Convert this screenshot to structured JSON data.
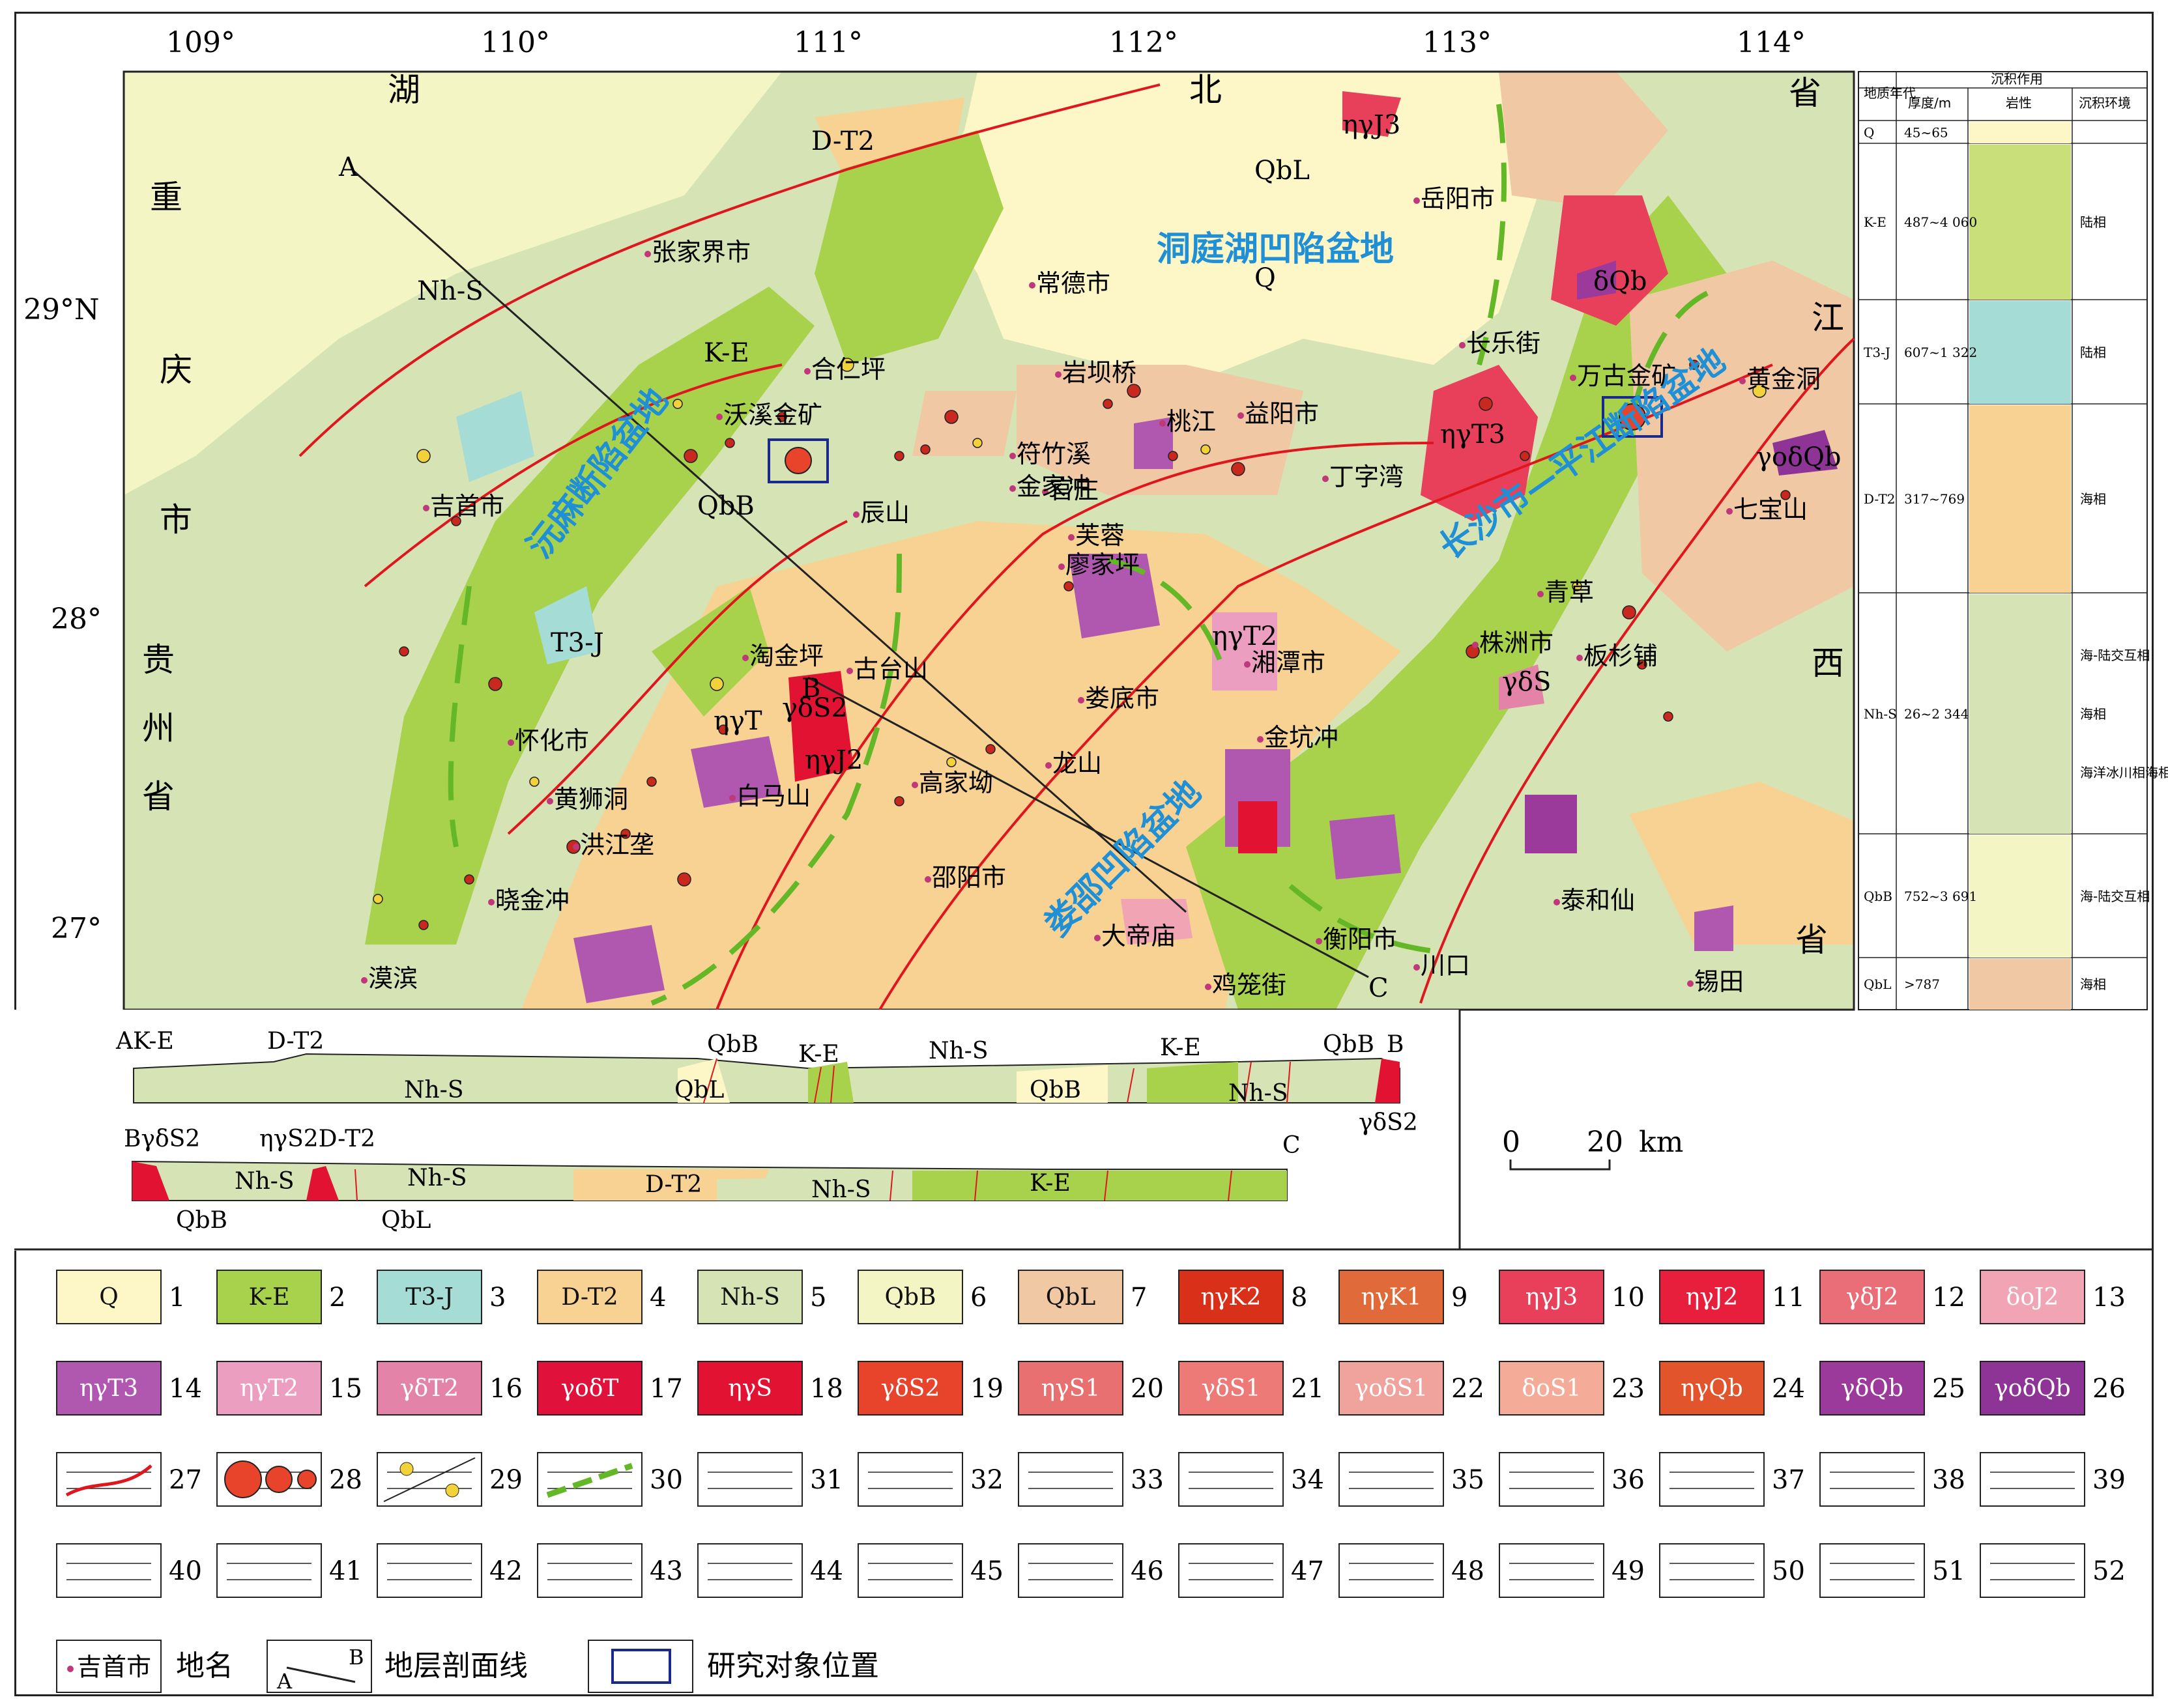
{
  "longitudes": [
    "109°",
    "110°",
    "111°",
    "112°",
    "113°",
    "114°"
  ],
  "latitudes": [
    "29°N",
    "28°",
    "27°"
  ],
  "province_labels": {
    "hubei": [
      "湖",
      "北",
      "省"
    ],
    "jiangxi": [
      "江",
      "西",
      "省"
    ],
    "chongqing": [
      "重",
      "庆",
      "市"
    ],
    "guizhou": [
      "贵",
      "州",
      "省"
    ]
  },
  "basin_labels": {
    "dongting": "洞庭湖凹陷盆地",
    "yuanma": "沅麻断陷盆地",
    "loushao": "娄邵凹陷盆地",
    "changping": "长沙市—平江断陷盆地"
  },
  "cities": [
    "张家界市",
    "常德市",
    "岳阳市",
    "吉首市",
    "桃江",
    "益阳市",
    "丁字湾",
    "辰山",
    "芙蓉",
    "廖家坪",
    "湘潭市",
    "株洲市",
    "板杉铺",
    "怀化市",
    "黄狮洞",
    "洪江垄",
    "高家坳",
    "邵阳市",
    "娄底市",
    "龙山",
    "金坑冲",
    "衡阳市",
    "川口",
    "漠滨",
    "大帝庙",
    "鸡笼街",
    "锡田",
    "泰和仙",
    "沃溪金矿",
    "万古金矿",
    "黄金洞",
    "七宝山",
    "青草",
    "淘金坪",
    "古台山",
    "岩坝桥",
    "符竹溪",
    "官庄",
    "长乐街",
    "白马山",
    "晓金冲",
    "合仁坪",
    "金家冲"
  ],
  "map_units": [
    "D-T2",
    "QbL",
    "Q",
    "Nh-S",
    "K-E",
    "QbB",
    "T3-J",
    "ηγJ3",
    "ηγT3",
    "ηγT2",
    "γδS",
    "δQb",
    "γoδQb",
    "ηγT",
    "γδS2",
    "ηγJ2"
  ],
  "section_points": [
    "A",
    "B",
    "C"
  ],
  "section_ab": {
    "labels": [
      "AK-E",
      "D-T2",
      "QbB",
      "K-E",
      "Nh-S",
      "K-E",
      "QbB",
      "Nh-S",
      "QbL",
      "QbB",
      "Nh-S",
      "γδS2"
    ]
  },
  "section_bc": {
    "labels": [
      "BγδS2",
      "ηγS2D-T2",
      "Nh-S",
      "Nh-S",
      "QbB",
      "QbL",
      "D-T2",
      "Nh-S",
      "K-E",
      "C"
    ]
  },
  "scale_bar": {
    "start": "0",
    "end": "20",
    "unit": "km"
  },
  "column": {
    "header_top": "沉积作用",
    "headers": [
      "地质年代",
      "厚度/m",
      "岩性",
      "沉积环境"
    ],
    "rows": [
      {
        "age": "Q",
        "thickness": "45~65",
        "env": ""
      },
      {
        "age": "K-E",
        "thickness": "487~4 060",
        "env": "陆相"
      },
      {
        "age": "T3-J",
        "thickness": "607~1 322",
        "env": "陆相"
      },
      {
        "age": "D-T2",
        "thickness": "317~769",
        "env": "海相"
      },
      {
        "age": "Nh-S",
        "thickness": "26~2 344",
        "env": "海-陆交互相 / 海相 / 海洋冰川相海相"
      },
      {
        "age": "QbB",
        "thickness": "752~3 691",
        "env": "海-陆交互相"
      },
      {
        "age": "QbL",
        "thickness": ">787",
        "env": "海相"
      }
    ]
  },
  "legend": {
    "row1": [
      {
        "code": "Q",
        "n": "1",
        "color": "#fdf7c8"
      },
      {
        "code": "K-E",
        "n": "2",
        "color": "#a8d24c"
      },
      {
        "code": "T3-J",
        "n": "3",
        "color": "#a6dcd6"
      },
      {
        "code": "D-T2",
        "n": "4",
        "color": "#f7d292"
      },
      {
        "code": "Nh-S",
        "n": "5",
        "color": "#d6e3b4"
      },
      {
        "code": "QbB",
        "n": "6",
        "color": "#f3f5c4"
      },
      {
        "code": "QbL",
        "n": "7",
        "color": "#f0c8a4"
      },
      {
        "code": "ηγK2",
        "n": "8",
        "color": "#d9301a"
      },
      {
        "code": "ηγK1",
        "n": "9",
        "color": "#e06a3a"
      },
      {
        "code": "ηγJ3",
        "n": "10",
        "color": "#e8405a"
      },
      {
        "code": "ηγJ2",
        "n": "11",
        "color": "#e81f3c"
      },
      {
        "code": "γδJ2",
        "n": "12",
        "color": "#ea6e78"
      },
      {
        "code": "δoJ2",
        "n": "13",
        "color": "#f0a4b4"
      }
    ],
    "row2": [
      {
        "code": "ηγT3",
        "n": "14",
        "color": "#b058b0"
      },
      {
        "code": "ηγT2",
        "n": "15",
        "color": "#ec9ec0"
      },
      {
        "code": "γδT2",
        "n": "16",
        "color": "#e383a7"
      },
      {
        "code": "γoδT",
        "n": "17",
        "color": "#e0113a"
      },
      {
        "code": "ηγS",
        "n": "18",
        "color": "#e21232"
      },
      {
        "code": "γδS2",
        "n": "19",
        "color": "#e8442c"
      },
      {
        "code": "ηγS1",
        "n": "20",
        "color": "#e87070"
      },
      {
        "code": "γδS1",
        "n": "21",
        "color": "#ee7a78"
      },
      {
        "code": "γoδS1",
        "n": "22",
        "color": "#f0a29c"
      },
      {
        "code": "δoS1",
        "n": "23",
        "color": "#f4ac98"
      },
      {
        "code": "ηγQb",
        "n": "24",
        "color": "#e2542c"
      },
      {
        "code": "γδQb",
        "n": "25",
        "color": "#9c3a9c"
      },
      {
        "code": "γoδQb",
        "n": "26",
        "color": "#8e3496"
      }
    ],
    "row3_numbers": [
      "27",
      "28",
      "29",
      "30",
      "31",
      "32",
      "33",
      "34",
      "35",
      "36",
      "37",
      "38",
      "39"
    ],
    "row4_numbers": [
      "40",
      "41",
      "42",
      "43",
      "44",
      "45",
      "46",
      "47",
      "48",
      "49",
      "50",
      "51",
      "52"
    ],
    "place_sample": "吉首市",
    "place_label": "地名",
    "section_label": "地层剖面线",
    "study_label": "研究对象位置"
  }
}
